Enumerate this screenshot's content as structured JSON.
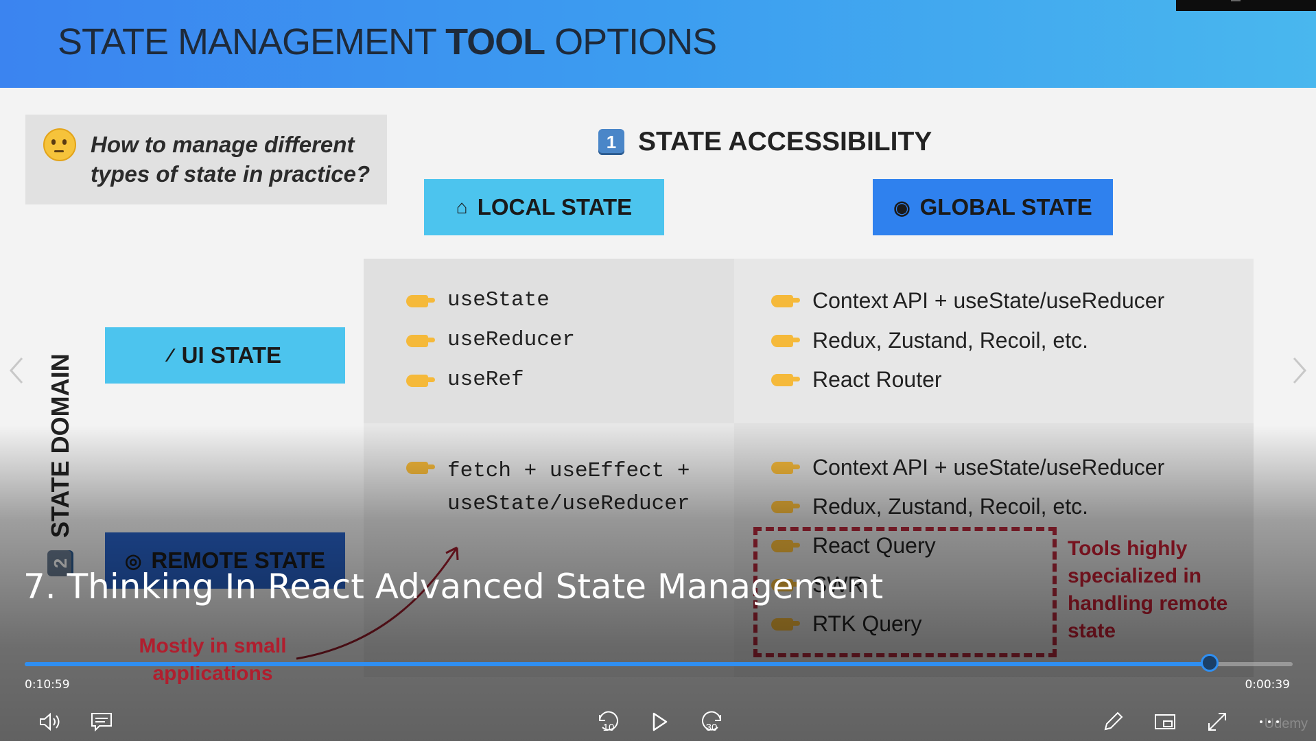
{
  "slide": {
    "title_prefix": "STATE MANAGEMENT ",
    "title_bold": "TOOL",
    "title_suffix": " OPTIONS",
    "question": "How to manage different types of state in practice?",
    "accessibility": {
      "number": "1",
      "label": "STATE ACCESSIBILITY"
    },
    "domain": {
      "number": "2",
      "label": "STATE DOMAIN"
    },
    "columns": {
      "local": "LOCAL STATE",
      "global": "GLOBAL STATE"
    },
    "rows": {
      "ui": "UI STATE",
      "remote": "REMOTE STATE"
    },
    "ui_local": [
      "useState",
      "useReducer",
      "useRef"
    ],
    "ui_global": [
      "Context API + useState/useReducer",
      "Redux, Zustand, Recoil, etc.",
      "React Router"
    ],
    "remote_local": [
      "fetch + useEffect +",
      "useState/useReducer"
    ],
    "remote_global": [
      "Context API + useState/useReducer",
      "Redux, Zustand, Recoil, etc.",
      "React Query",
      "SWR",
      "RTK Query"
    ],
    "remote_note": "Tools highly specialized in handling remote state",
    "small_note": "Mostly in small applications"
  },
  "player": {
    "video_title": "7. Thinking In React Advanced State Management",
    "elapsed": "0:10:59",
    "remaining": "0:00:39",
    "progress_fraction": 0.9345,
    "rewind_label": "10",
    "forward_label": "30",
    "watermark": "Udemy",
    "accent": "#2f8ff2"
  }
}
